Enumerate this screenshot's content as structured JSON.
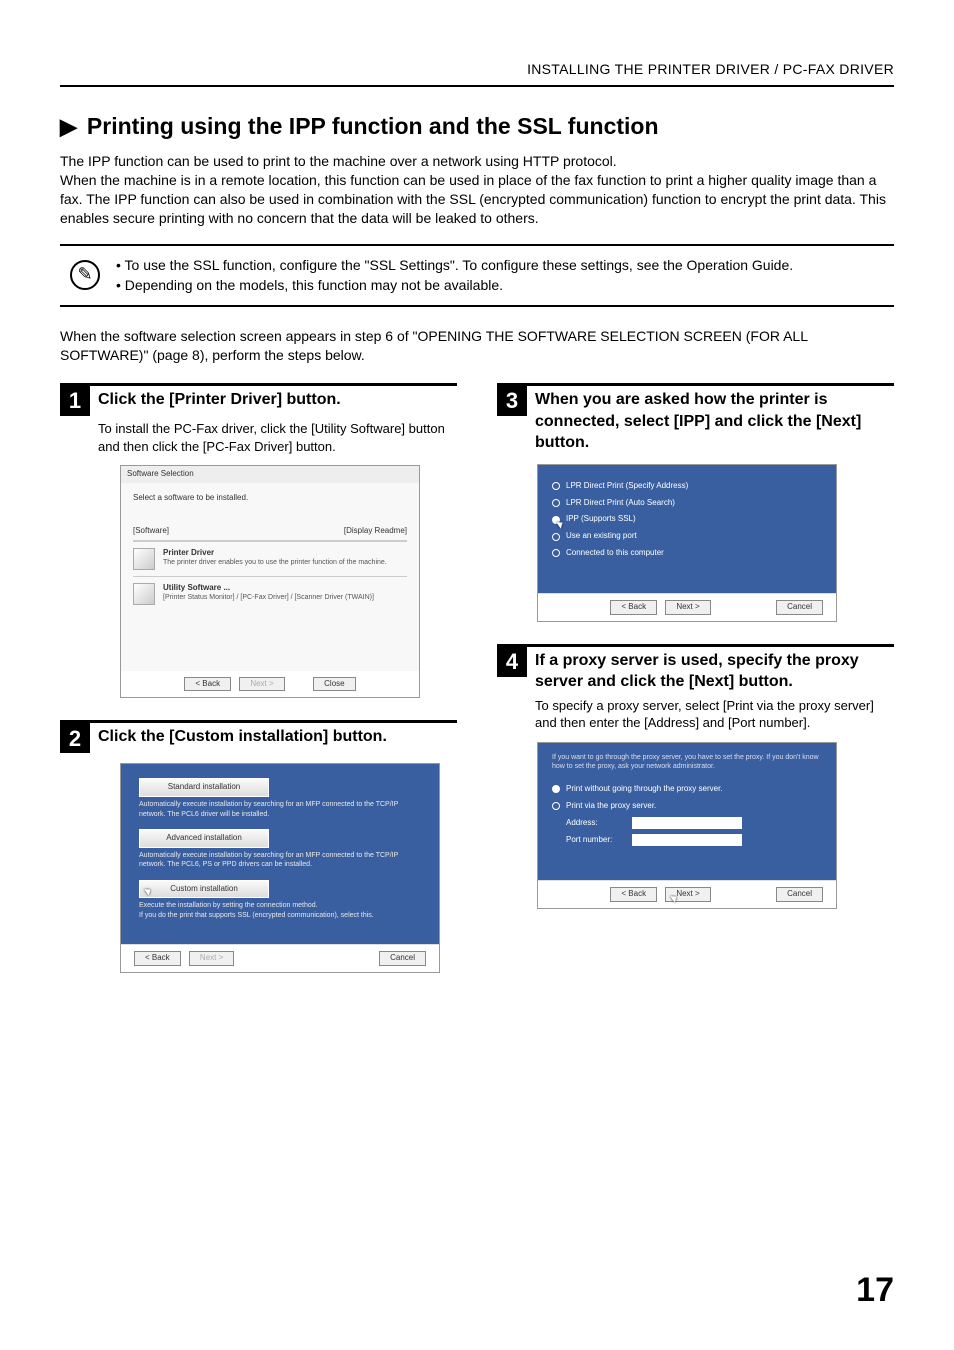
{
  "header": "INSTALLING THE PRINTER DRIVER / PC-FAX DRIVER",
  "title": "Printing using the IPP function and the SSL function",
  "intro": {
    "p1": "The IPP function can be used to print to the machine over a network using HTTP protocol.",
    "p2": "When the machine is in a remote location, this function can be used in place of the fax function to print a higher quality image than a fax. The IPP function can also be used in combination with the SSL (encrypted communication) function to encrypt the print data. This enables secure printing with no concern that the data will be leaked to others."
  },
  "note": {
    "b1": "• To use the SSL function, configure the \"SSL Settings\". To configure these settings, see the Operation Guide.",
    "b2": "• Depending on the models, this function may not be available."
  },
  "prestep": "When the software selection screen appears in step 6 of \"OPENING THE SOFTWARE SELECTION SCREEN (FOR ALL SOFTWARE)\" (page 8), perform the steps below.",
  "steps": {
    "s1": {
      "num": "1",
      "title": "Click the [Printer Driver] button.",
      "body": "To install the PC-Fax driver, click the [Utility Software] button and then click the [PC-Fax Driver] button."
    },
    "s2": {
      "num": "2",
      "title": "Click the [Custom installation] button."
    },
    "s3": {
      "num": "3",
      "title": "When you are asked how the printer is connected, select [IPP] and click the [Next] button."
    },
    "s4": {
      "num": "4",
      "title": "If a proxy server is used, specify the proxy server and click the [Next] button.",
      "body": "To specify a proxy server, select [Print via the proxy server] and then enter the [Address] and [Port number]."
    }
  },
  "dlg1": {
    "wintitle": "Software Selection",
    "heading": "Select a software to be installed.",
    "tabs_left": "[Software]",
    "tabs_right": "[Display Readme]",
    "item1_name": "Printer Driver",
    "item1_desc": "The printer driver enables you to use the printer function of the machine.",
    "item2_name": "Utility Software ...",
    "item2_desc": "[Printer Status Monitor] / [PC-Fax Driver] / [Scanner Driver (TWAIN)]",
    "back": "< Back",
    "next": "Next >",
    "close": "Close"
  },
  "dlg2": {
    "btn_std": "Standard installation",
    "desc_std": "Automatically execute installation by searching for an MFP connected to the TCP/IP network. The PCL6 driver will be installed.",
    "btn_adv": "Advanced installation",
    "desc_adv": "Automatically execute installation by searching for an MFP connected to the TCP/IP network. The PCL6, PS or PPD drivers can be installed.",
    "btn_cus": "Custom installation",
    "desc_cus": "Execute the installation by setting the connection method.\nIf you do the print that supports SSL (encrypted communication), select this.",
    "back": "< Back",
    "next": "Next >",
    "cancel": "Cancel"
  },
  "dlg3": {
    "opt1": "LPR Direct Print (Specify Address)",
    "opt2": "LPR Direct Print (Auto Search)",
    "opt3": "IPP (Supports SSL)",
    "opt4": "Use an existing port",
    "opt5": "Connected to this computer",
    "back": "< Back",
    "next": "Next >",
    "cancel": "Cancel"
  },
  "dlg4": {
    "top_note": "If you want to go through the proxy server, you have to set the proxy. If you don't know how to set the proxy, ask your network administrator.",
    "opt1": "Print without going through the proxy server.",
    "opt2": "Print via the proxy server.",
    "addr_label": "Address:",
    "port_label": "Port number:",
    "back": "< Back",
    "next": "Next >",
    "cancel": "Cancel"
  },
  "page_number": "17"
}
